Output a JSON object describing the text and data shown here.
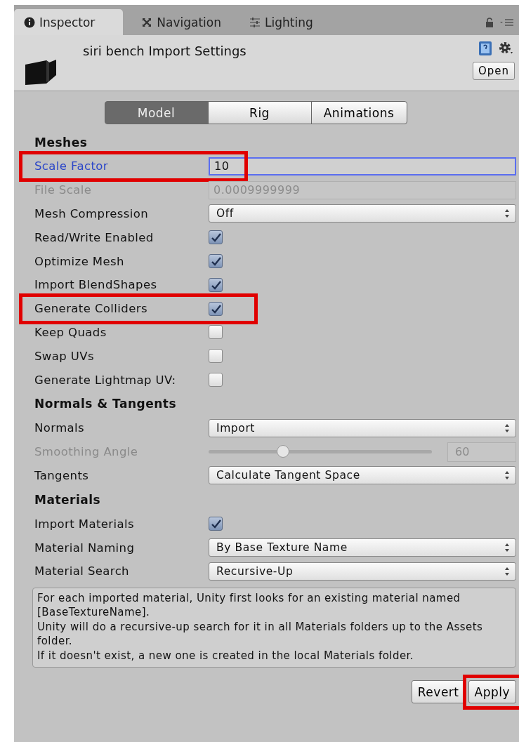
{
  "tabs": [
    {
      "label": "Inspector",
      "selected": true
    },
    {
      "label": "Navigation",
      "selected": false
    },
    {
      "label": "Lighting",
      "selected": false
    }
  ],
  "header": {
    "title": "siri bench Import Settings",
    "open_button": "Open"
  },
  "mode_tabs": [
    {
      "label": "Model",
      "selected": true
    },
    {
      "label": "Rig",
      "selected": false
    },
    {
      "label": "Animations",
      "selected": false
    }
  ],
  "sections": [
    {
      "heading": "Meshes",
      "rows": [
        {
          "kind": "input",
          "label": "Scale Factor",
          "value": "10",
          "focused": true,
          "disabled": false,
          "highlighted": true
        },
        {
          "kind": "input",
          "label": "File Scale",
          "value": "0.0009999999",
          "focused": false,
          "disabled": true,
          "highlighted": false
        },
        {
          "kind": "dropdown",
          "label": "Mesh Compression",
          "value": "Off",
          "focused": false,
          "disabled": false,
          "highlighted": false
        },
        {
          "kind": "checkbox",
          "label": "Read/Write Enabled",
          "checked": true,
          "focused": false,
          "disabled": false,
          "highlighted": false
        },
        {
          "kind": "checkbox",
          "label": "Optimize Mesh",
          "checked": true,
          "focused": false,
          "disabled": false,
          "highlighted": false
        },
        {
          "kind": "checkbox",
          "label": "Import BlendShapes",
          "checked": true,
          "focused": false,
          "disabled": false,
          "highlighted": false
        },
        {
          "kind": "checkbox",
          "label": "Generate Colliders",
          "checked": true,
          "focused": false,
          "disabled": false,
          "highlighted": true
        },
        {
          "kind": "checkbox",
          "label": "Keep Quads",
          "checked": false,
          "focused": false,
          "disabled": false,
          "highlighted": false
        },
        {
          "kind": "checkbox",
          "label": "Swap UVs",
          "checked": false,
          "focused": false,
          "disabled": false,
          "highlighted": false
        },
        {
          "kind": "checkbox",
          "label": "Generate Lightmap UV:",
          "checked": false,
          "focused": false,
          "disabled": false,
          "highlighted": false
        }
      ]
    },
    {
      "heading": "Normals & Tangents",
      "rows": [
        {
          "kind": "dropdown",
          "label": "Normals",
          "value": "Import",
          "focused": false,
          "disabled": false,
          "highlighted": false
        },
        {
          "kind": "slider",
          "label": "Smoothing Angle",
          "level": 0.333,
          "value": "60",
          "focused": false,
          "disabled": true,
          "highlighted": false
        },
        {
          "kind": "dropdown",
          "label": "Tangents",
          "value": "Calculate Tangent Space",
          "focused": false,
          "disabled": false,
          "highlighted": false
        }
      ]
    },
    {
      "heading": "Materials",
      "rows": [
        {
          "kind": "checkbox",
          "label": "Import Materials",
          "checked": true,
          "focused": false,
          "disabled": false,
          "highlighted": false
        },
        {
          "kind": "dropdown",
          "label": "Material Naming",
          "value": "By Base Texture Name",
          "focused": false,
          "disabled": false,
          "highlighted": false
        },
        {
          "kind": "dropdown",
          "label": "Material Search",
          "value": "Recursive-Up",
          "focused": false,
          "disabled": false,
          "highlighted": false
        }
      ]
    }
  ],
  "help_text": "For each imported material, Unity first looks for an existing material named [BaseTextureName].\nUnity will do a recursive-up search for it in all Materials folders up to the Assets folder.\nIf it doesn't exist, a new one is created in the local Materials folder.",
  "buttons": [
    {
      "label": "Revert",
      "highlighted": false
    },
    {
      "label": "Apply",
      "highlighted": true
    }
  ]
}
